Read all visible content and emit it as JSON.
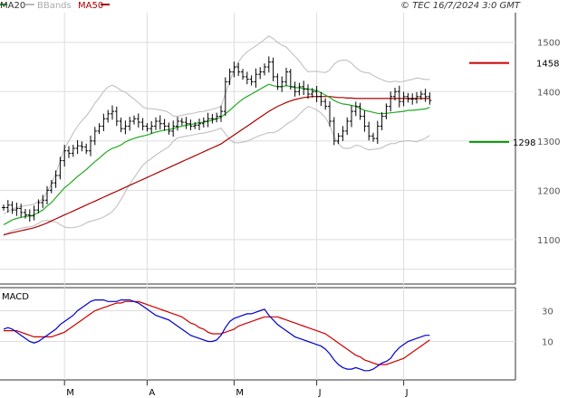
{
  "header": {
    "ma20_label": "MA20",
    "bbands_label": "BBands",
    "ma50_label": "MA50",
    "source": "© TEC 16/7/2024 3:0 GMT"
  },
  "macd_label": "MACD",
  "colors": {
    "ma20": "#22aa22",
    "ma50": "#aa0000",
    "bbands": "#bbbbbb",
    "price": "#000000",
    "resistance": "#cc0000",
    "support": "#009900",
    "macd": "#0000cc",
    "signal": "#cc0000",
    "grid": "#dddddd"
  },
  "levels": {
    "resistance": "1458",
    "support": "1298"
  },
  "chart_data": [
    {
      "type": "line",
      "title": "",
      "y_ticks": [
        1100,
        1200,
        1300,
        1400,
        1500
      ],
      "ylim": [
        1010,
        1560
      ],
      "x_ticks": [
        "M",
        "A",
        "M",
        "J",
        "J"
      ],
      "x_tick_index": [
        14,
        33,
        53,
        72,
        92
      ],
      "sessions": 104,
      "closes": [
        1165,
        1170,
        1160,
        1163,
        1155,
        1150,
        1148,
        1160,
        1175,
        1180,
        1200,
        1215,
        1230,
        1260,
        1280,
        1275,
        1285,
        1290,
        1288,
        1280,
        1300,
        1320,
        1330,
        1345,
        1355,
        1360,
        1340,
        1325,
        1330,
        1340,
        1345,
        1338,
        1330,
        1325,
        1330,
        1340,
        1335,
        1330,
        1320,
        1330,
        1340,
        1338,
        1335,
        1330,
        1332,
        1335,
        1340,
        1345,
        1345,
        1350,
        1360,
        1420,
        1440,
        1450,
        1440,
        1430,
        1425,
        1420,
        1435,
        1440,
        1450,
        1460,
        1430,
        1410,
        1420,
        1440,
        1410,
        1400,
        1410,
        1405,
        1395,
        1400,
        1390,
        1380,
        1370,
        1340,
        1300,
        1310,
        1320,
        1340,
        1360,
        1370,
        1350,
        1330,
        1310,
        1305,
        1330,
        1350,
        1370,
        1390,
        1400,
        1380,
        1390,
        1385,
        1385,
        1390,
        1395,
        1390,
        1382
      ],
      "series": [
        {
          "name": "MA20",
          "values": [
            1130,
            1135,
            1140,
            1143,
            1145,
            1147,
            1148,
            1150,
            1155,
            1160,
            1168,
            1175,
            1185,
            1195,
            1205,
            1212,
            1220,
            1228,
            1235,
            1242,
            1250,
            1258,
            1265,
            1273,
            1280,
            1285,
            1288,
            1292,
            1298,
            1302,
            1305,
            1308,
            1310,
            1312,
            1315,
            1318,
            1320,
            1322,
            1323,
            1325,
            1328,
            1330,
            1332,
            1333,
            1335,
            1337,
            1338,
            1340,
            1342,
            1345,
            1348,
            1355,
            1362,
            1370,
            1378,
            1385,
            1390,
            1395,
            1400,
            1405,
            1410,
            1415,
            1412,
            1410,
            1410,
            1412,
            1410,
            1408,
            1408,
            1406,
            1405,
            1404,
            1402,
            1398,
            1393,
            1388,
            1382,
            1378,
            1375,
            1374,
            1372,
            1370,
            1366,
            1362,
            1360,
            1358,
            1356,
            1355,
            1356,
            1357,
            1358,
            1359,
            1360,
            1362,
            1362,
            1363,
            1364,
            1365,
            1368
          ]
        },
        {
          "name": "MA50",
          "values": [
            1110,
            1112,
            1114,
            1116,
            1118,
            1120,
            1122,
            1124,
            1127,
            1130,
            1134,
            1138,
            1142,
            1146,
            1150,
            1154,
            1158,
            1162,
            1166,
            1170,
            1174,
            1178,
            1182,
            1186,
            1190,
            1194,
            1198,
            1202,
            1206,
            1210,
            1214,
            1218,
            1222,
            1226,
            1230,
            1234,
            1238,
            1242,
            1246,
            1250,
            1254,
            1258,
            1262,
            1266,
            1270,
            1274,
            1278,
            1282,
            1286,
            1290,
            1294,
            1300,
            1306,
            1312,
            1318,
            1324,
            1330,
            1336,
            1342,
            1348,
            1354,
            1360,
            1365,
            1370,
            1374,
            1378,
            1381,
            1384,
            1386,
            1388,
            1389,
            1390,
            1390,
            1390,
            1390,
            1390,
            1389,
            1388,
            1388,
            1387,
            1387,
            1386,
            1386,
            1386,
            1386,
            1386,
            1386,
            1386,
            1386,
            1386,
            1386,
            1386,
            1386,
            1386,
            1386,
            1386,
            1386,
            1386,
            1386
          ]
        }
      ]
    },
    {
      "type": "line",
      "title": "",
      "y_ticks": [
        10,
        30
      ],
      "ylim": [
        -15,
        45
      ],
      "series": [
        {
          "name": "MACD",
          "values": [
            18,
            19,
            18,
            16,
            14,
            12,
            10,
            9,
            10,
            12,
            14,
            16,
            18,
            21,
            23,
            25,
            27,
            30,
            32,
            34,
            36,
            37,
            37,
            37,
            36,
            36,
            36,
            37,
            37,
            37,
            36,
            35,
            33,
            31,
            29,
            27,
            26,
            25,
            24,
            22,
            20,
            18,
            16,
            14,
            13,
            12,
            11,
            10,
            10,
            11,
            14,
            19,
            23,
            25,
            26,
            27,
            28,
            28,
            29,
            30,
            31,
            27,
            24,
            21,
            19,
            17,
            15,
            13,
            12,
            11,
            10,
            9,
            8,
            7,
            5,
            2,
            -2,
            -5,
            -7,
            -8,
            -8,
            -7,
            -8,
            -9,
            -9,
            -8,
            -6,
            -4,
            -3,
            -1,
            3,
            6,
            8,
            10,
            11,
            12,
            13,
            14,
            14
          ]
        },
        {
          "name": "Signal",
          "values": [
            17,
            17,
            17,
            17,
            16,
            15,
            14,
            13,
            13,
            13,
            13,
            13,
            14,
            15,
            16,
            18,
            20,
            22,
            24,
            26,
            28,
            30,
            31,
            32,
            33,
            34,
            35,
            35,
            36,
            36,
            36,
            36,
            35,
            34,
            33,
            32,
            31,
            30,
            29,
            28,
            27,
            26,
            24,
            22,
            21,
            19,
            18,
            16,
            15,
            15,
            15,
            16,
            17,
            18,
            20,
            21,
            22,
            23,
            24,
            25,
            26,
            26,
            26,
            26,
            25,
            24,
            23,
            22,
            21,
            20,
            19,
            18,
            17,
            16,
            15,
            13,
            11,
            9,
            7,
            5,
            3,
            1,
            0,
            -2,
            -3,
            -4,
            -5,
            -5,
            -5,
            -4,
            -3,
            -2,
            -1,
            1,
            3,
            5,
            7,
            9,
            11
          ]
        }
      ]
    }
  ]
}
